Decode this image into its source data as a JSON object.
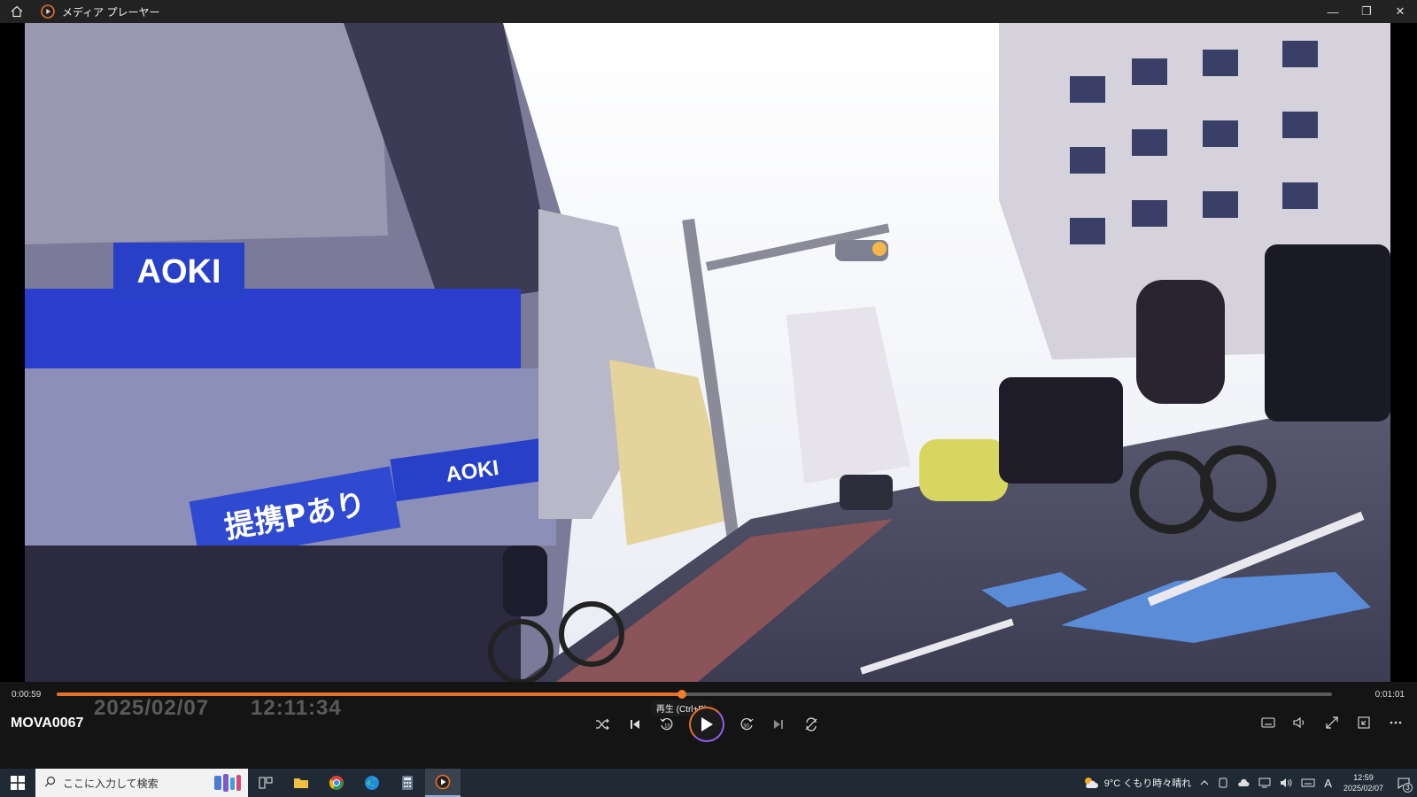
{
  "window": {
    "title": "メディア プレーヤー",
    "controls": {
      "minimize": "—",
      "restore": "❐",
      "close": "✕"
    }
  },
  "player": {
    "elapsed": "0:00:59",
    "duration": "0:01:01",
    "progress_fraction": 0.49,
    "tooltip": "再生 (Ctrl+P)",
    "filename": "MOVA0067",
    "video_overlay_date": "2025/02/07",
    "video_overlay_time": "12:11:34",
    "accent": "#e8702a",
    "icons": {
      "shuffle": "shuffle-icon",
      "previous": "previous-icon",
      "rewind": "rewind-10-icon",
      "play": "play-icon",
      "forward": "forward-30-icon",
      "next": "next-icon",
      "repeat": "repeat-off-icon",
      "subtitles": "subtitles-icon",
      "volume": "volume-icon",
      "fullscreen": "fullscreen-icon",
      "miniplayer": "miniplayer-icon",
      "more": "more-icon"
    },
    "rewind_label": "10",
    "forward_label": "30"
  },
  "video_scene": {
    "store_sign": "AOKI",
    "store_sign_2": "AOKI",
    "banner_text": "提携Pあり"
  },
  "taskbar": {
    "search_placeholder": "ここに入力して検索",
    "weather": "9°C くもり時々晴れ",
    "ime": "A",
    "time": "12:59",
    "date": "2025/02/07",
    "notification_count": "3"
  }
}
